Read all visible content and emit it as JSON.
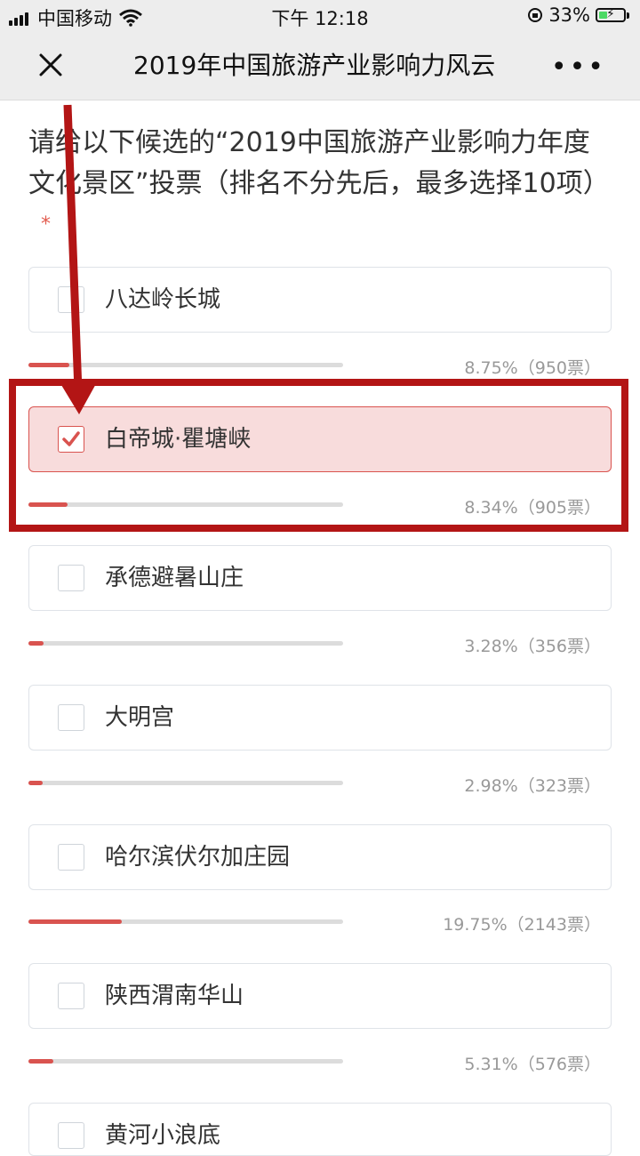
{
  "status_bar": {
    "carrier": "中国移动",
    "time": "下午 12:18",
    "battery": "33%"
  },
  "nav": {
    "title": "2019年中国旅游产业影响力风云"
  },
  "question": {
    "text": "请给以下候选的“2019中国旅游产业影响力年度文化景区”投票（排名不分先后，最多选择10项）",
    "required_mark": "*"
  },
  "options": [
    {
      "label": "八达岭长城",
      "stat": "8.75%（950票）",
      "percent": 8.75,
      "votes": 950,
      "selected": false
    },
    {
      "label": "白帝城·瞿塘峡",
      "stat": "8.34%（905票）",
      "percent": 8.34,
      "votes": 905,
      "selected": true
    },
    {
      "label": "承德避暑山庄",
      "stat": "3.28%（356票）",
      "percent": 3.28,
      "votes": 356,
      "selected": false
    },
    {
      "label": "大明宫",
      "stat": "2.98%（323票）",
      "percent": 2.98,
      "votes": 323,
      "selected": false
    },
    {
      "label": "哈尔滨伏尔加庄园",
      "stat": "19.75%（2143票）",
      "percent": 19.75,
      "votes": 2143,
      "selected": false
    },
    {
      "label": "陕西渭南华山",
      "stat": "5.31%（576票）",
      "percent": 5.31,
      "votes": 576,
      "selected": false
    },
    {
      "label": "黄河小浪底",
      "stat": "",
      "percent": null,
      "votes": null,
      "selected": false
    }
  ],
  "colors": {
    "accent": "#d9534f",
    "annotation": "#b31515",
    "selected_bg": "#f8dcdc"
  },
  "icons": {
    "close": "close-icon",
    "more": "more-icon",
    "signal": "signal-icon",
    "wifi": "wifi-icon",
    "lock": "orientation-lock-icon",
    "battery": "battery-icon",
    "check": "checkmark-icon"
  }
}
